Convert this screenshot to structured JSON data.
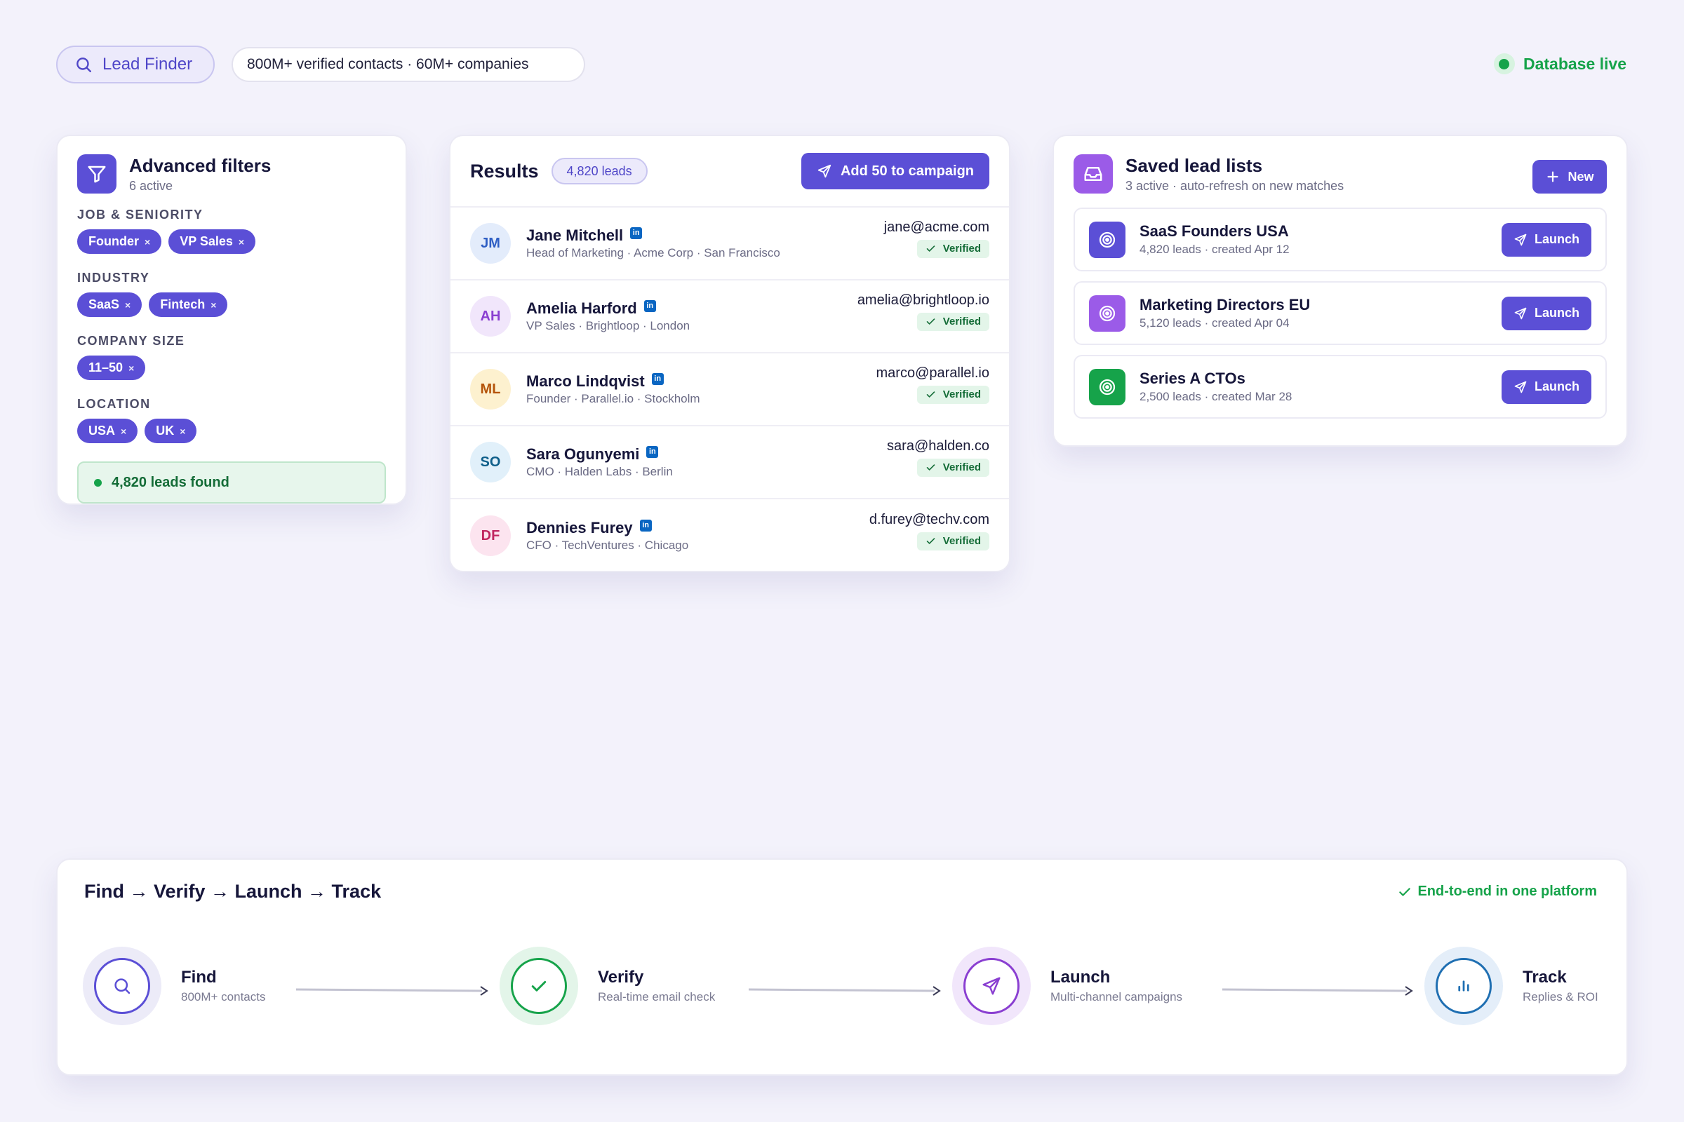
{
  "topbar": {
    "finder_label": "Lead Finder",
    "stats": "800M+ verified contacts · 60M+ companies",
    "status": "Database live"
  },
  "filters": {
    "title": "Advanced filters",
    "subtitle": "6 active",
    "groups": [
      {
        "label": "JOB & SENIORITY",
        "chips": [
          "Founder",
          "VP Sales"
        ]
      },
      {
        "label": "INDUSTRY",
        "chips": [
          "SaaS",
          "Fintech"
        ]
      },
      {
        "label": "COMPANY SIZE",
        "chips": [
          "11–50"
        ]
      },
      {
        "label": "LOCATION",
        "chips": [
          "USA",
          "UK"
        ]
      }
    ],
    "chip_remove": "×",
    "found": "4,820 leads found"
  },
  "results": {
    "title": "Results",
    "count": "4,820 leads",
    "campaign_button": "Add 50 to campaign",
    "linkedin_glyph": "in",
    "verified_label": "Verified",
    "rows": [
      {
        "initials": "JM",
        "name": "Jane Mitchell",
        "sub": "Head of Marketing · Acme Corp · San Francisco",
        "email": "jane@acme.com",
        "avatar_bg": "#e3ecfb",
        "avatar_fg": "#2f5fc4"
      },
      {
        "initials": "AH",
        "name": "Amelia Harford",
        "sub": "VP Sales · Brightloop · London",
        "email": "amelia@brightloop.io",
        "avatar_bg": "#f1e6fb",
        "avatar_fg": "#8a3fd1"
      },
      {
        "initials": "ML",
        "name": "Marco Lindqvist",
        "sub": "Founder · Parallel.io · Stockholm",
        "email": "marco@parallel.io",
        "avatar_bg": "#fdf1cf",
        "avatar_fg": "#b45309"
      },
      {
        "initials": "SO",
        "name": "Sara Ogunyemi",
        "sub": "CMO · Halden Labs · Berlin",
        "email": "sara@halden.co",
        "avatar_bg": "#e1f0fa",
        "avatar_fg": "#0f5f8a"
      },
      {
        "initials": "DF",
        "name": "Dennies Furey",
        "sub": "CFO · TechVentures · Chicago",
        "email": "d.furey@techv.com",
        "avatar_bg": "#fce4ef",
        "avatar_fg": "#c0265f"
      }
    ]
  },
  "saved": {
    "title": "Saved lead lists",
    "subtitle": "3 active · auto-refresh on new matches",
    "new_button": "New",
    "launch_label": "Launch",
    "lists": [
      {
        "name": "SaaS Founders USA",
        "sub": "4,820 leads · created Apr 12",
        "color": "#5b4fd6"
      },
      {
        "name": "Marketing Directors EU",
        "sub": "5,120 leads · created Apr 04",
        "color": "#9b5be8"
      },
      {
        "name": "Series A CTOs",
        "sub": "2,500 leads · created Mar 28",
        "color": "#16a34a"
      }
    ]
  },
  "flow": {
    "title": "Find → Verify → Launch → Track",
    "badge": "End-to-end in one platform",
    "steps": [
      {
        "name": "Find",
        "sub": "800M+ contacts",
        "icon": "search-icon",
        "ring": "#ecebf8",
        "stroke": "#5b4fd6"
      },
      {
        "name": "Verify",
        "sub": "Real-time email check",
        "icon": "check-icon",
        "ring": "#e3f5e9",
        "stroke": "#16a34a"
      },
      {
        "name": "Launch",
        "sub": "Multi-channel campaigns",
        "icon": "send-icon",
        "ring": "#f1e6fb",
        "stroke": "#8a3fd1"
      },
      {
        "name": "Track",
        "sub": "Replies & ROI",
        "icon": "bar-chart-icon",
        "ring": "#e4eef9",
        "stroke": "#1f6fb2"
      }
    ]
  }
}
